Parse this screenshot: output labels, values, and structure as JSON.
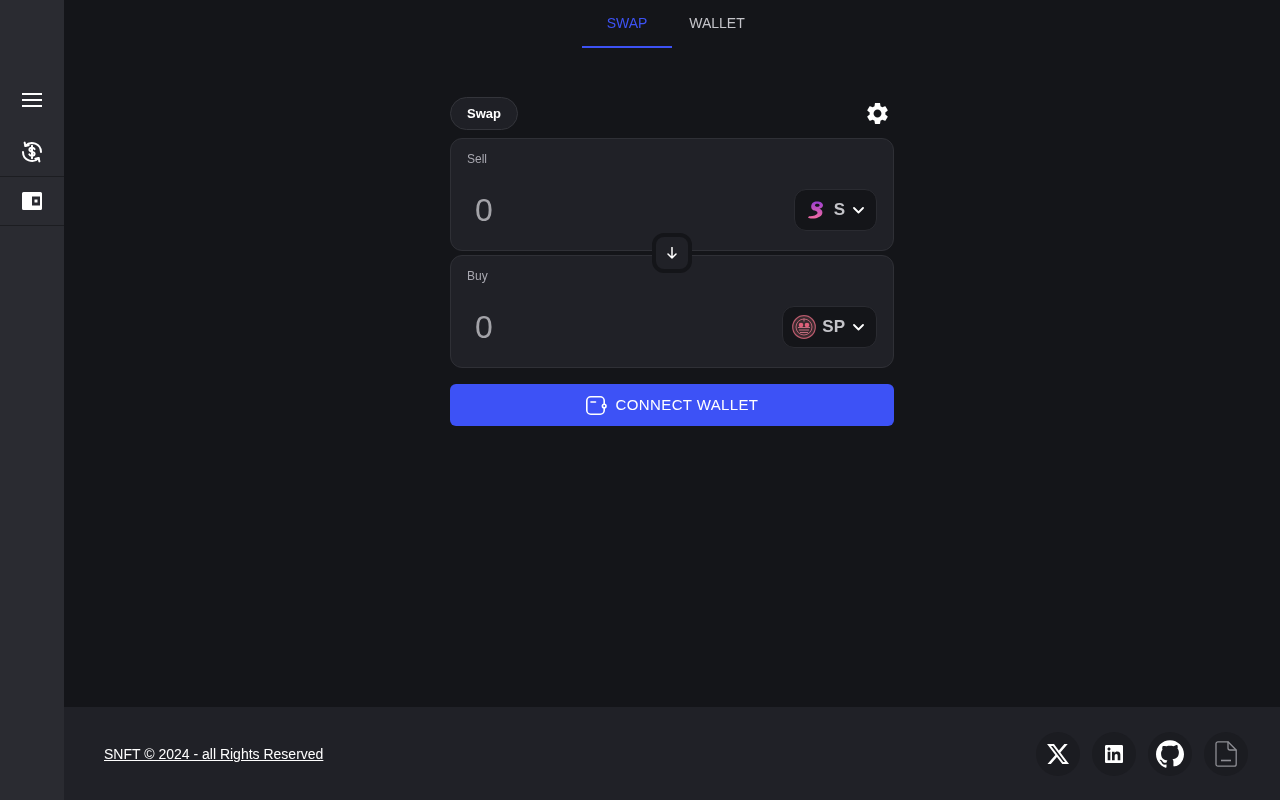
{
  "tabs": [
    {
      "label": "SWAP",
      "selected": true
    },
    {
      "label": "WALLET",
      "selected": false
    }
  ],
  "swap": {
    "mode_label": "Swap",
    "panels": [
      {
        "label": "Sell",
        "placeholder": "0",
        "token": "S"
      },
      {
        "label": "Buy",
        "placeholder": "0",
        "token": "SP"
      }
    ],
    "connect_button": "CONNECT WALLET"
  },
  "footer": {
    "copyright": "SNFT © 2024 - all Rights Reserved"
  }
}
